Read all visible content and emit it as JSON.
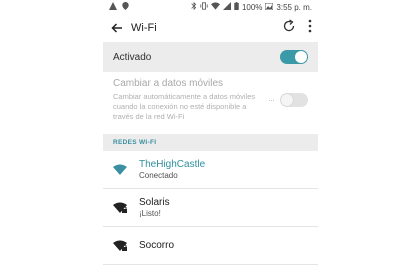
{
  "statusbar": {
    "battery": "100%",
    "time": "3:55 p. m."
  },
  "appbar": {
    "title": "Wi-Fi"
  },
  "wifi_toggle": {
    "label": "Activado",
    "state": "on"
  },
  "mobile_data": {
    "title": "Cambiar a datos móviles",
    "description": "Cambiar automáticamente a datos móviles cuando la conexión no esté disponible a través de la red Wi-Fi",
    "state": "off"
  },
  "networks_section": {
    "header": "REDES WI-FI"
  },
  "networks": [
    {
      "name": "TheHighCastle",
      "status": "Conectado",
      "icon": "wifi-connected-icon"
    },
    {
      "name": "Solaris",
      "status": "¡Listo!",
      "icon": "wifi-locked-icon"
    },
    {
      "name": "Socorro",
      "status": "",
      "icon": "wifi-locked-icon"
    }
  ],
  "colors": {
    "accent": "#3a9aa8",
    "section_bg": "#ececec"
  }
}
